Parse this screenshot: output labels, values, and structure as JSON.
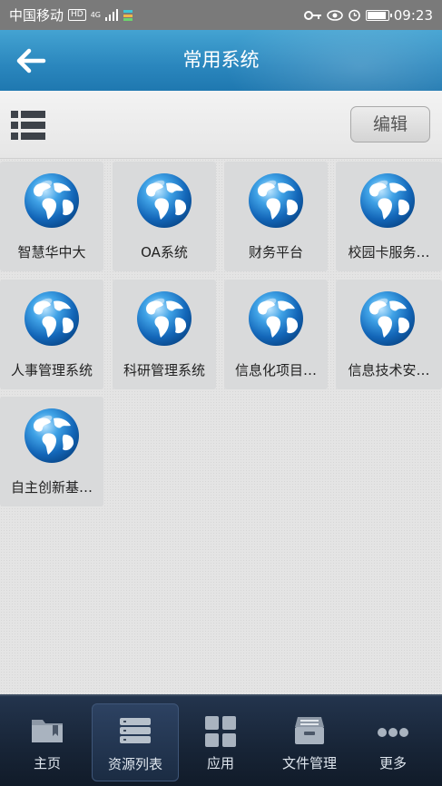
{
  "status_bar": {
    "carrier": "中国移动",
    "hd": "HD",
    "network": "4G",
    "time": "09:23",
    "battery_level": 0.85
  },
  "header": {
    "title": "常用系统"
  },
  "toolbar": {
    "edit_label": "编辑"
  },
  "apps": [
    {
      "label": "智慧华中大"
    },
    {
      "label": "OA系统"
    },
    {
      "label": "财务平台"
    },
    {
      "label": "校园卡服务…"
    },
    {
      "label": "人事管理系统"
    },
    {
      "label": "科研管理系统"
    },
    {
      "label": "信息化项目…"
    },
    {
      "label": "信息技术安…"
    },
    {
      "label": "自主创新基…"
    }
  ],
  "bottom_nav": [
    {
      "label": "主页",
      "icon": "folder-icon",
      "active": false
    },
    {
      "label": "资源列表",
      "icon": "server-list-icon",
      "active": true
    },
    {
      "label": "应用",
      "icon": "apps-grid-icon",
      "active": false
    },
    {
      "label": "文件管理",
      "icon": "file-cabinet-icon",
      "active": false
    },
    {
      "label": "更多",
      "icon": "more-dots-icon",
      "active": false
    }
  ],
  "colors": {
    "header_blue": "#2a86bd",
    "nav_dark": "#172436"
  }
}
